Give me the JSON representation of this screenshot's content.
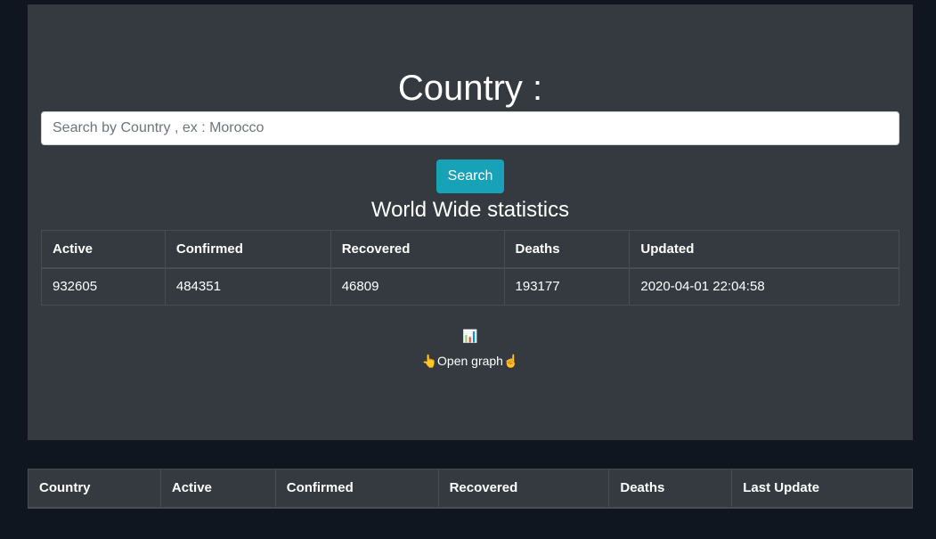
{
  "header": {
    "title": "Country :"
  },
  "search": {
    "placeholder": "Search by Country , ex : Morocco",
    "value": "",
    "button_label": "Search"
  },
  "world": {
    "heading": "World Wide statistics",
    "columns": [
      "Active",
      "Confirmed",
      "Recovered",
      "Deaths",
      "Updated"
    ],
    "row": [
      "932605",
      "484351",
      "46809",
      "193177",
      "2020-04-01 22:04:58"
    ]
  },
  "graph": {
    "icon_glyph": "📊",
    "icon_name": "bar-chart-icon",
    "link_text": "👆Open graph☝"
  },
  "countries": {
    "columns": [
      "Country",
      "Active",
      "Confirmed",
      "Recovered",
      "Deaths",
      "Last Update"
    ]
  }
}
